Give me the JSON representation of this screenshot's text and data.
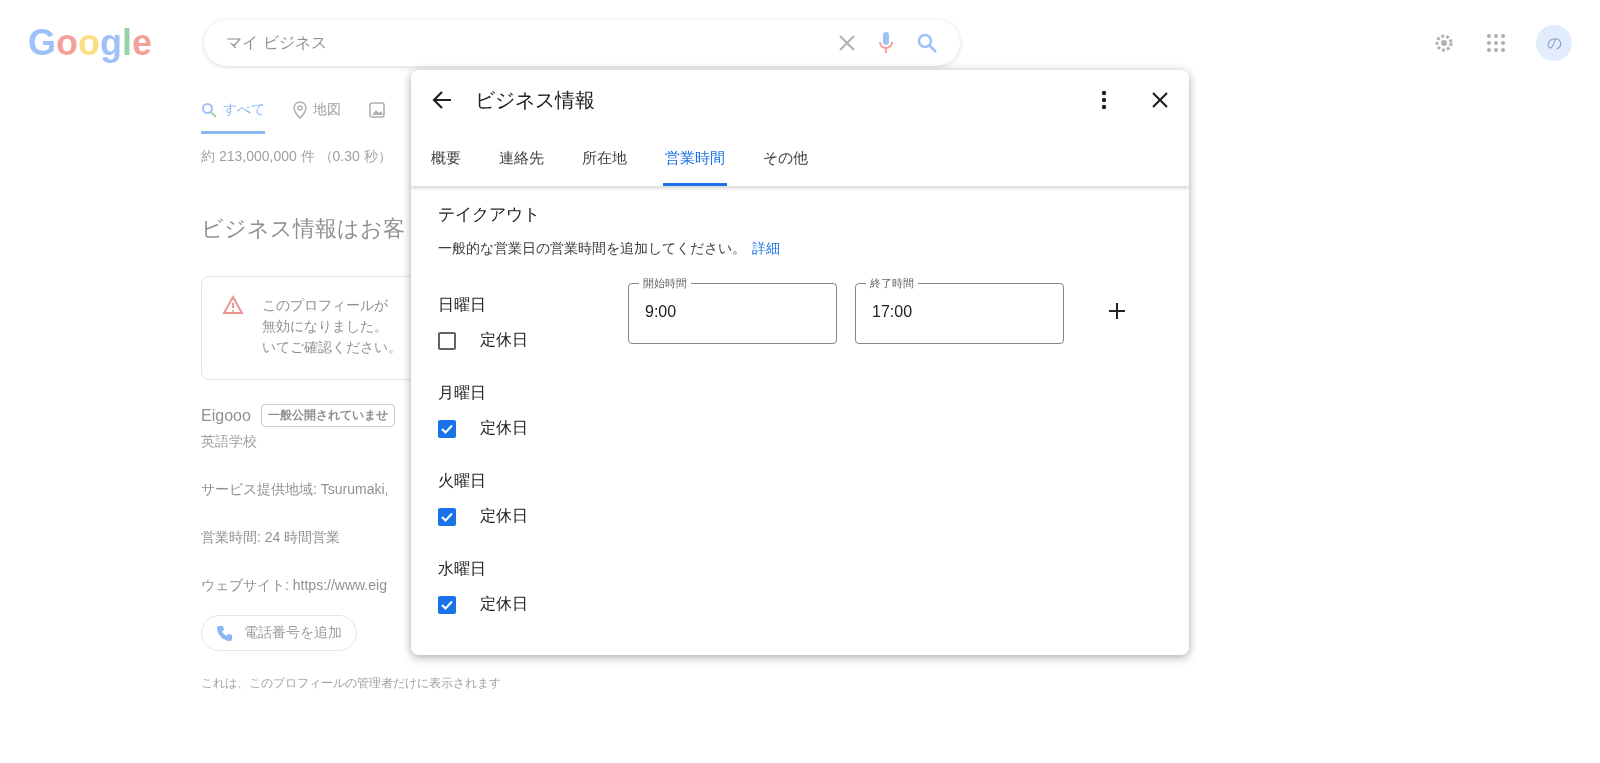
{
  "logo": "Google",
  "search": {
    "value": "マイ ビジネス"
  },
  "avatar": {
    "letter": "の"
  },
  "result_tabs": [
    {
      "label": "すべて",
      "selected": true
    },
    {
      "label": "地図",
      "selected": false
    },
    {
      "selected": false
    }
  ],
  "result_count": "約 213,000,000 件 （0.30 秒）",
  "heading": "ビジネス情報はお客",
  "alert": {
    "lines": [
      "このプロフィールが",
      "無効になりました。",
      "いてご確認ください。"
    ]
  },
  "business": {
    "name": "Eigooo",
    "badge": "一般公開されていませ",
    "category": "英語学校",
    "service_area": "サービス提供地域: Tsurumaki,",
    "hours": "営業時間: 24 時間営業",
    "website": "ウェブサイト: https://www.eig",
    "phone_button": "電話番号を追加",
    "note": "これは、このプロフィールの管理者だけに表示されます"
  },
  "dialog": {
    "title": "ビジネス情報",
    "tabs": [
      {
        "label": "概要",
        "selected": false
      },
      {
        "label": "連絡先",
        "selected": false
      },
      {
        "label": "所在地",
        "selected": false
      },
      {
        "label": "営業時間",
        "selected": true
      },
      {
        "label": "その他",
        "selected": false
      }
    ],
    "section_title": "テイクアウト",
    "description": "一般的な営業日の営業時間を追加してください。",
    "link": "詳細",
    "days": [
      {
        "name": "日曜日",
        "closed_label": "定休日",
        "closed": false,
        "start_label": "開始時間",
        "start": "9:00",
        "end_label": "終了時間",
        "end": "17:00"
      },
      {
        "name": "月曜日",
        "closed_label": "定休日",
        "closed": true
      },
      {
        "name": "火曜日",
        "closed_label": "定休日",
        "closed": true
      },
      {
        "name": "水曜日",
        "closed_label": "定休日",
        "closed": true
      }
    ]
  }
}
